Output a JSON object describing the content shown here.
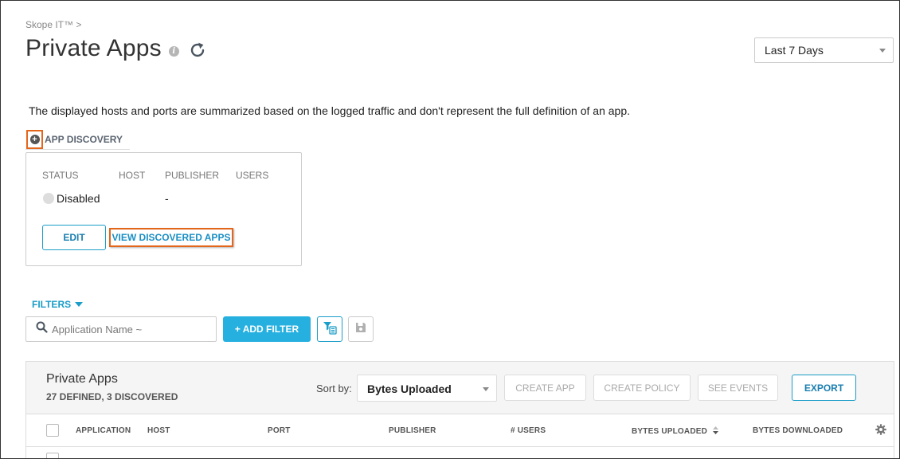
{
  "breadcrumb": "Skope IT™ >",
  "page_title": "Private Apps",
  "date_range": {
    "selected": "Last 7 Days"
  },
  "notice": "The displayed hosts and ports are summarized based on the logged traffic and don't represent the full definition of an app.",
  "app_discovery": {
    "tab_label": "APP DISCOVERY",
    "columns": [
      "STATUS",
      "HOST",
      "PUBLISHER",
      "USERS"
    ],
    "status": "Disabled",
    "publisher": "-",
    "edit_label": "EDIT",
    "view_label": "VIEW DISCOVERED APPS"
  },
  "filters": {
    "toggle_label": "FILTERS",
    "search_placeholder": "Application Name ~",
    "add_filter_label": "+ ADD FILTER"
  },
  "table": {
    "title": "Private Apps",
    "subtitle": "27 DEFINED, 3 DISCOVERED",
    "sort_label": "Sort by:",
    "sort_value": "Bytes Uploaded",
    "buttons": {
      "create_app": "CREATE APP",
      "create_policy": "CREATE POLICY",
      "see_events": "SEE EVENTS",
      "export": "EXPORT"
    },
    "columns": {
      "application": "APPLICATION",
      "host": "HOST",
      "port": "PORT",
      "publisher": "PUBLISHER",
      "users": "# USERS",
      "bytes_uploaded": "BYTES UPLOADED",
      "bytes_downloaded": "BYTES DOWNLOADED"
    }
  },
  "colors": {
    "accent": "#1a9dc8",
    "primary_button": "#26b0df",
    "highlight": "#e3661b"
  }
}
